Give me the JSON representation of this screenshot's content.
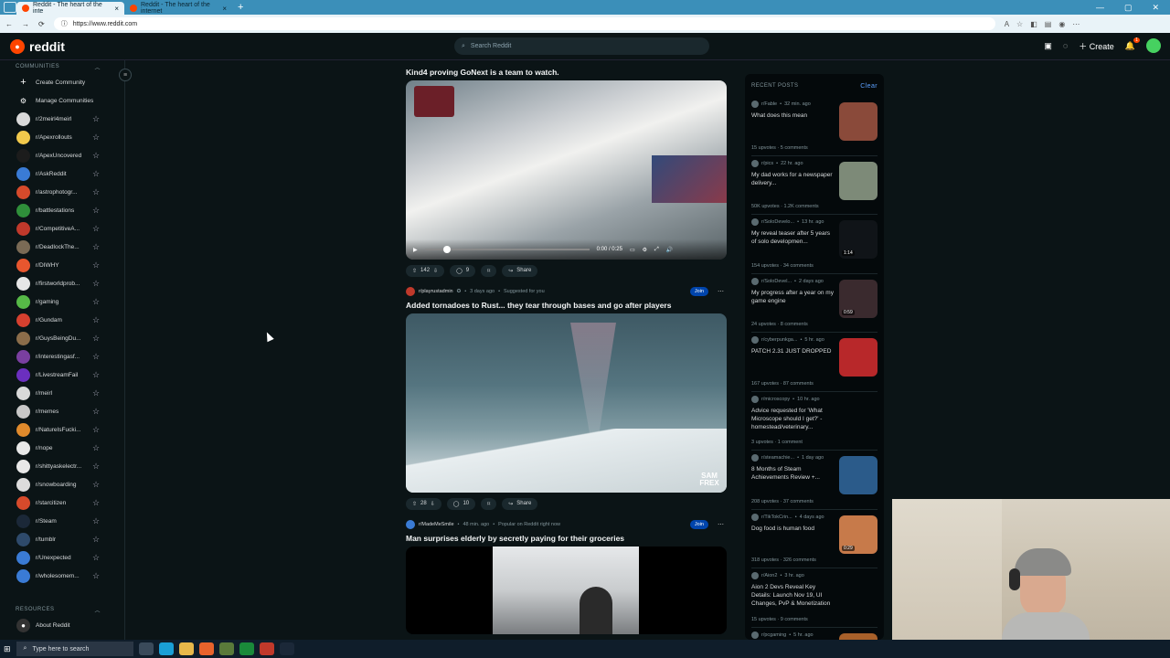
{
  "browser": {
    "tabs": [
      {
        "title": "Reddit - The heart of the inte",
        "active": true
      },
      {
        "title": "Reddit - The heart of the internet",
        "active": false
      }
    ],
    "url": "https://www.reddit.com"
  },
  "header": {
    "brand": "reddit",
    "search_placeholder": "Search Reddit",
    "create_label": "Create",
    "notification_count": "1"
  },
  "sidebar": {
    "communities_heading": "COMMUNITIES",
    "create_community": "Create Community",
    "manage_communities": "Manage Communities",
    "communities": [
      {
        "name": "r/2meirl4meirl",
        "color": "#d9d9d9"
      },
      {
        "name": "r/Apexrollouts",
        "color": "#f2c94c"
      },
      {
        "name": "r/ApexUncovered",
        "color": "#1c1c1c"
      },
      {
        "name": "r/AskReddit",
        "color": "#3a7bd5"
      },
      {
        "name": "r/astrophotogr...",
        "color": "#d64a2b"
      },
      {
        "name": "r/battlestations",
        "color": "#2f8f3a"
      },
      {
        "name": "r/CompetitiveA...",
        "color": "#c0392b"
      },
      {
        "name": "r/DeadlockThe...",
        "color": "#7a6a55"
      },
      {
        "name": "r/DIWHY",
        "color": "#e8562e"
      },
      {
        "name": "r/firstworldprob...",
        "color": "#e6e6e6"
      },
      {
        "name": "r/gaming",
        "color": "#56b947"
      },
      {
        "name": "r/Gundam",
        "color": "#d6402f"
      },
      {
        "name": "r/GuysBeingDu...",
        "color": "#8b6d4a"
      },
      {
        "name": "r/interestingasf...",
        "color": "#7a3fa0"
      },
      {
        "name": "r/LivestreamFail",
        "color": "#6b2fbf"
      },
      {
        "name": "r/meirl",
        "color": "#d9d9d9"
      },
      {
        "name": "r/memes",
        "color": "#c8c8c8"
      },
      {
        "name": "r/NatureIsFucki...",
        "color": "#e08a2c"
      },
      {
        "name": "r/nope",
        "color": "#e8e8e8"
      },
      {
        "name": "r/shittyaskelectr...",
        "color": "#e8e8e8"
      },
      {
        "name": "r/snowboarding",
        "color": "#dcdcdc"
      },
      {
        "name": "r/starcitizen",
        "color": "#d64a2b"
      },
      {
        "name": "r/Steam",
        "color": "#1b2838"
      },
      {
        "name": "r/tumblr",
        "color": "#2e4a6b"
      },
      {
        "name": "r/Unexpected",
        "color": "#3a7bd5"
      },
      {
        "name": "r/wholesomem...",
        "color": "#3a7bd5"
      }
    ],
    "resources_heading": "RESOURCES",
    "about_reddit": "About Reddit"
  },
  "feed": {
    "posts": [
      {
        "title": "Kind4 proving GoNext is a team to watch.",
        "video_time": "0:00 / 0:25",
        "upvotes": "142",
        "comments": "9",
        "share": "Share"
      },
      {
        "subreddit": "r/playrustadmin",
        "time": "3 days ago",
        "suggested": "Suggested for you",
        "join": "Join",
        "title": "Added tornadoes to Rust... they tear through bases and go after players",
        "upvotes": "28",
        "comments": "10",
        "share": "Share",
        "watermark": "SAM FREX"
      },
      {
        "subreddit": "r/MadeMeSmile",
        "time": "48 min. ago",
        "popular": "Popular on Reddit right now",
        "join": "Join",
        "title": "Man surprises elderly by secretly paying for their groceries"
      }
    ]
  },
  "recent": {
    "heading": "RECENT POSTS",
    "clear": "Clear",
    "items": [
      {
        "sub": "r/Fable",
        "time": "32 min. ago",
        "title": "What does this mean",
        "stats": "15 upvotes · 5 comments",
        "thumb": "#8a4a3a"
      },
      {
        "sub": "r/pics",
        "time": "22 hr. ago",
        "title": "My dad works for a newspaper delivery...",
        "stats": "50K upvotes · 1.2K comments",
        "thumb": "#7d8a78"
      },
      {
        "sub": "r/SoloDevelo...",
        "time": "13 hr. ago",
        "title": "My reveal teaser after 5 years of solo developmen...",
        "stats": "154 upvotes · 34 comments",
        "thumb": "#101418",
        "badge": "1:14"
      },
      {
        "sub": "r/SoloDevel...",
        "time": "2 days ago",
        "title": "My progress after a year on my game engine",
        "stats": "24 upvotes · 8 comments",
        "thumb": "#3a2a2e",
        "badge": "0:59"
      },
      {
        "sub": "r/cyberpunkga...",
        "time": "5 hr. ago",
        "title": "PATCH 2.31 JUST DROPPED",
        "stats": "167 upvotes · 87 comments",
        "thumb": "#b8282a"
      },
      {
        "sub": "r/microscopy",
        "time": "10 hr. ago",
        "title": "Advice requested for 'What Microscope should I get?' - homestead/veterinary...",
        "stats": "3 upvotes · 1 comment",
        "thumb": ""
      },
      {
        "sub": "r/steamachie...",
        "time": "1 day ago",
        "title": "8 Months of Steam Achievements Review +...",
        "stats": "208 upvotes · 37 comments",
        "thumb": "#2b5b8a"
      },
      {
        "sub": "r/TikTokCrin...",
        "time": "4 days ago",
        "title": "Dog food is human food",
        "stats": "318 upvotes · 326 comments",
        "thumb": "#c77a4a",
        "badge": "0:29"
      },
      {
        "sub": "r/Aion2",
        "time": "3 hr. ago",
        "title": "Aion 2 Devs Reveal Key Details: Launch Nov 19, UI Changes, PvP & Monetization",
        "stats": "15 upvotes · 9 comments",
        "thumb": ""
      },
      {
        "sub": "r/pcgaming",
        "time": "5 hr. ago",
        "title": "",
        "stats": "",
        "thumb": "#a8602a"
      }
    ]
  },
  "taskbar": {
    "search_placeholder": "Type here to search"
  }
}
